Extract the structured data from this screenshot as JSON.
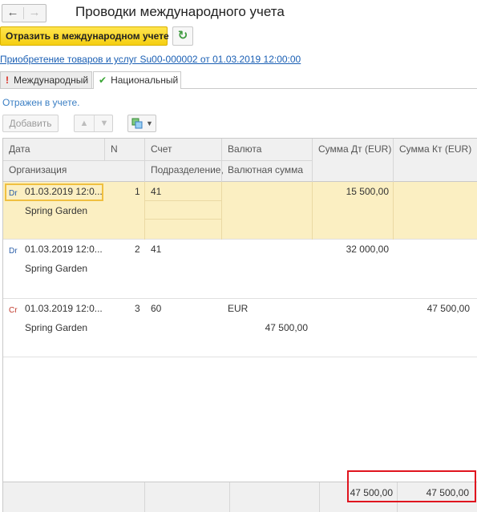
{
  "header": {
    "back_icon": "arrow-left-icon",
    "forward_icon": "arrow-right-icon",
    "title": "Проводки международного учета"
  },
  "actions": {
    "reflect_label": "Отразить в международном учете",
    "refresh_icon": "refresh-icon"
  },
  "document_link": "Приобретение товаров и услуг Su00-000002 от 01.03.2019 12:00:00",
  "tabs": [
    {
      "label": "Международный",
      "icon": "exclamation-icon"
    },
    {
      "label": "Национальный",
      "icon": "checkmark-icon"
    }
  ],
  "status_text": "Отражен в учете.",
  "toolbar": {
    "add_label": "Добавить",
    "up_icon": "arrow-up-icon",
    "down_icon": "arrow-down-icon",
    "menu_icon": "copy-icon"
  },
  "table": {
    "headers": {
      "date": "Дата",
      "n": "N",
      "account": "Счет",
      "currency": "Валюта",
      "sum_dt": "Сумма Дт (EUR)",
      "sum_kt": "Сумма Кт (EUR)",
      "organization": "Организация",
      "subdivision": "Подразделение,",
      "currency_sum": "Валютная сумма"
    },
    "rows": [
      {
        "type": "Dr",
        "date": "01.03.2019 12:0...",
        "n": "1",
        "account": "41",
        "currency": "",
        "sum_dt": "15 500,00",
        "sum_kt": "",
        "organization": "Spring Garden",
        "currency_sum": ""
      },
      {
        "type": "Dr",
        "date": "01.03.2019 12:0...",
        "n": "2",
        "account": "41",
        "currency": "",
        "sum_dt": "32 000,00",
        "sum_kt": "",
        "organization": "Spring Garden",
        "currency_sum": ""
      },
      {
        "type": "Cr",
        "date": "01.03.2019 12:0...",
        "n": "3",
        "account": "60",
        "currency": "EUR",
        "sum_dt": "",
        "sum_kt": "47 500,00",
        "organization": "Spring Garden",
        "currency_sum": "47 500,00"
      }
    ],
    "totals": {
      "sum_dt": "47 500,00",
      "sum_kt": "47 500,00"
    }
  },
  "colors": {
    "accent_yellow": "#f5cf12",
    "highlight_red": "#e0141e",
    "link_blue": "#1a5fb4"
  }
}
